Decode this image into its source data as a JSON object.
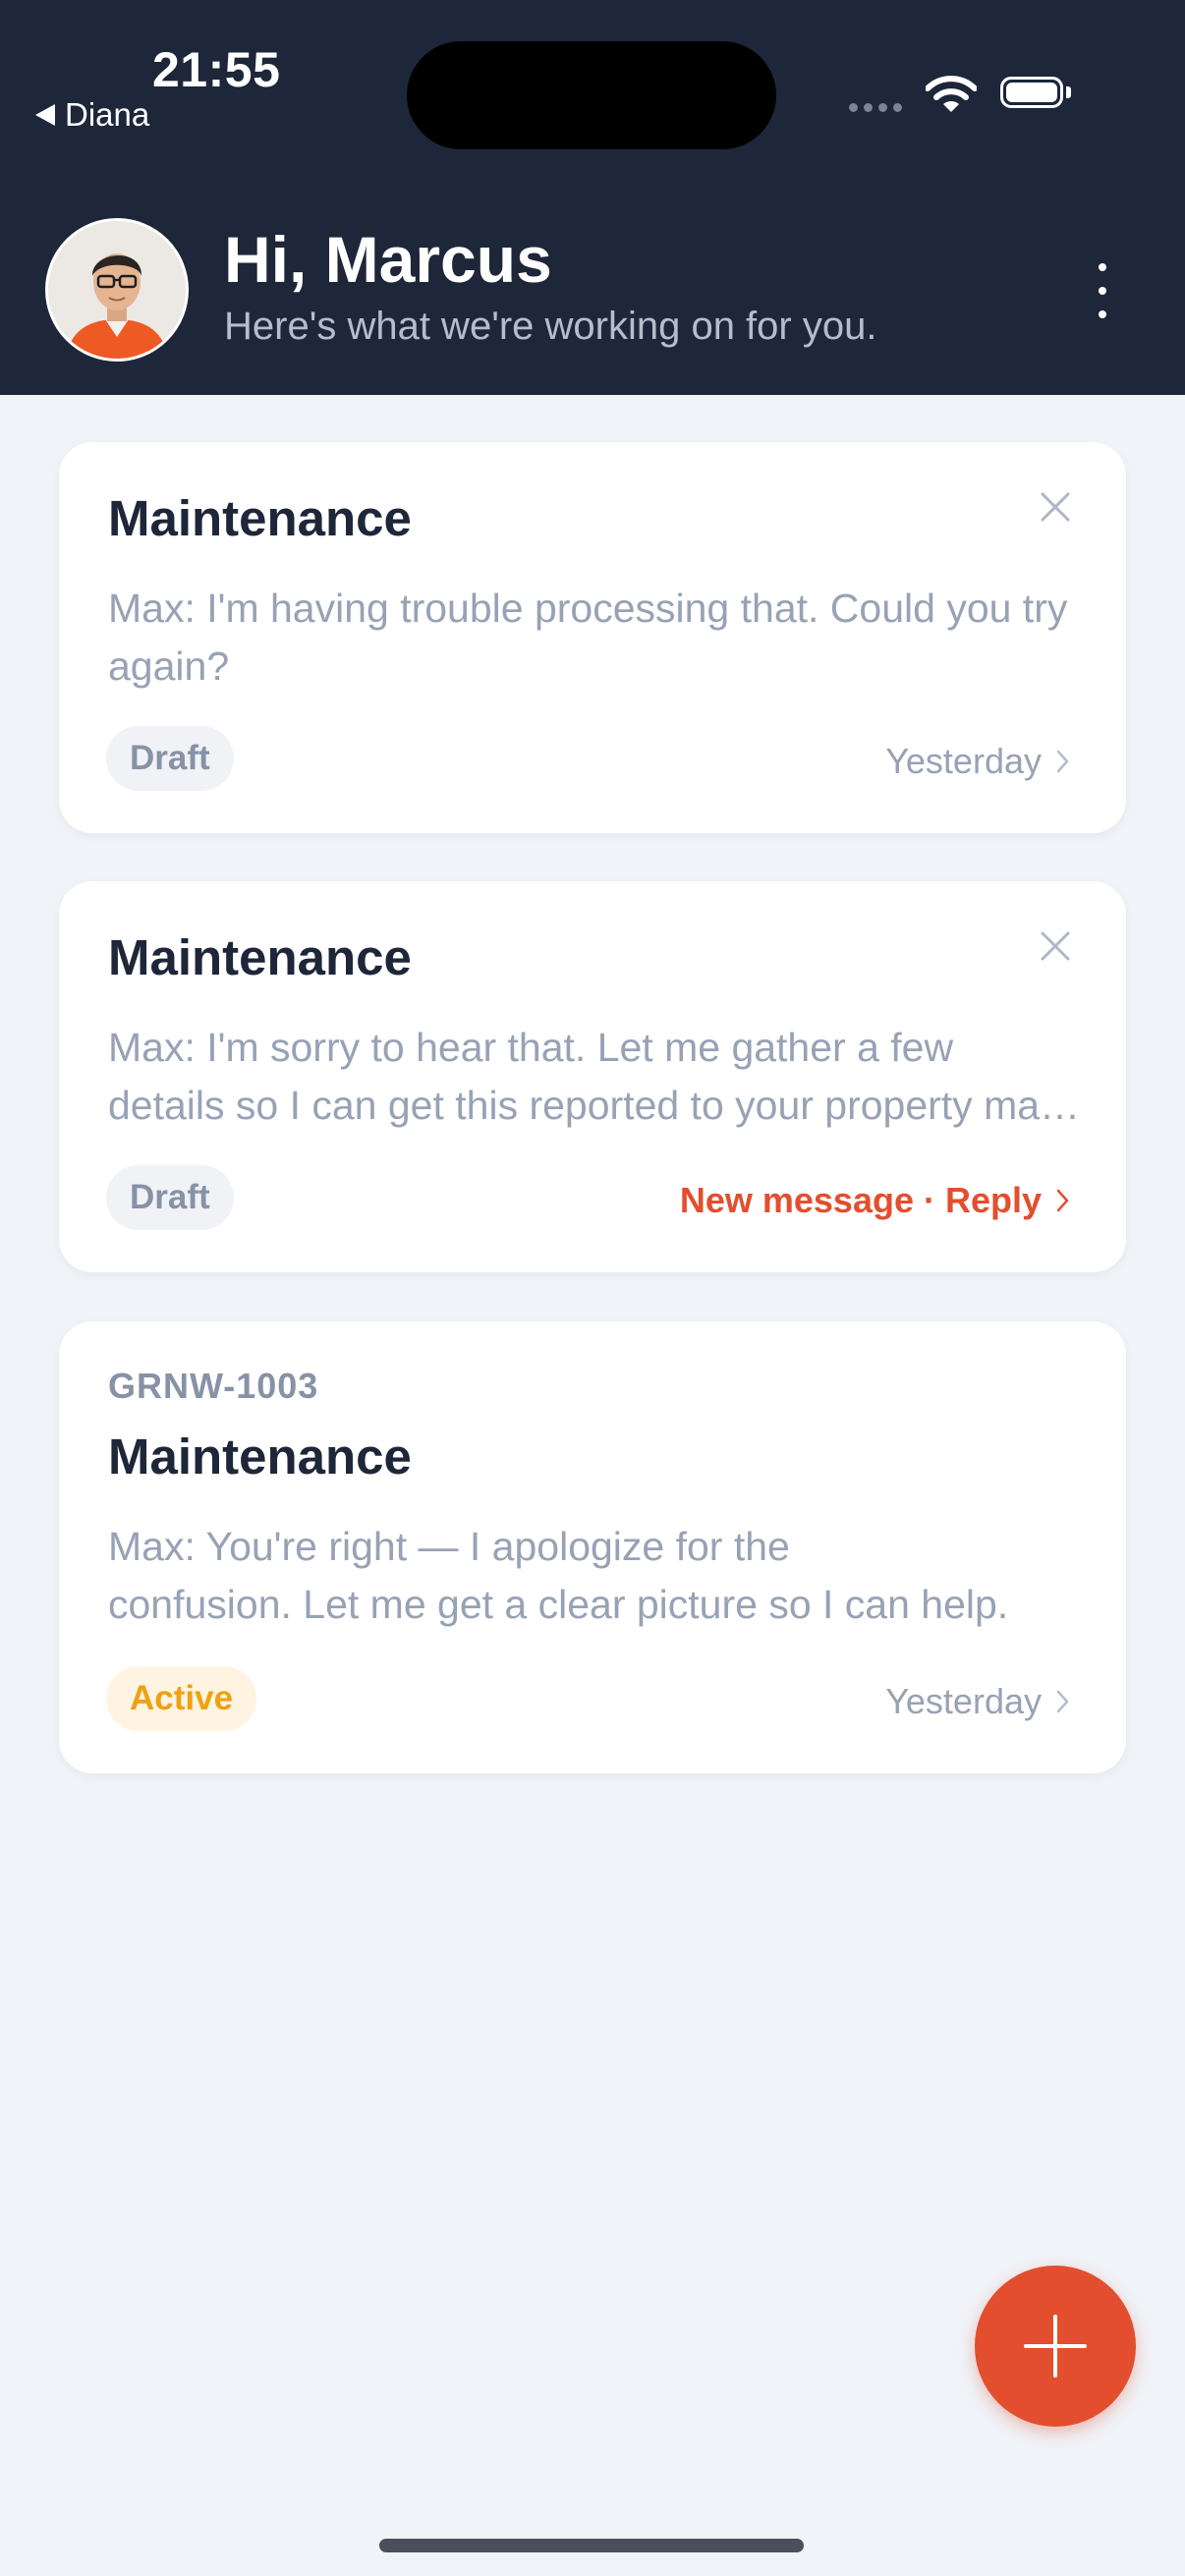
{
  "status_bar": {
    "time": "21:55",
    "back_app": "Diana"
  },
  "header": {
    "greeting": "Hi, Marcus",
    "subtitle": "Here's what we're working on for you.",
    "avatar_icon": "user-avatar-photo",
    "menu_icon": "more-vertical-icon"
  },
  "cards": [
    {
      "title": "Maintenance",
      "preview": "Max: I'm having trouble processing that. Could you try again?",
      "badge": "Draft",
      "meta": "Yesterday"
    },
    {
      "title": "Maintenance",
      "preview_line1": "Max: I'm sorry to hear that. Let me gather a few",
      "preview_line2": "details so I can get this reported to your property manager.",
      "badge": "Draft",
      "meta": "New message · Reply"
    },
    {
      "reference": "GRNW-1003",
      "title": "Maintenance",
      "preview_line1": "Max: You're right — I apologize for the",
      "preview_line2": "confusion. Let me get a clear picture so I can help.",
      "badge": "Active",
      "meta": "Yesterday"
    }
  ],
  "fab": {
    "icon": "plus-icon"
  },
  "colors": {
    "header_bg": "#1e2639",
    "page_bg": "#f0f3f8",
    "accent": "#e34e2e",
    "active_badge_text": "#f0a012",
    "active_badge_bg": "#fff4e2",
    "draft_badge_bg": "#f0f2f6"
  }
}
